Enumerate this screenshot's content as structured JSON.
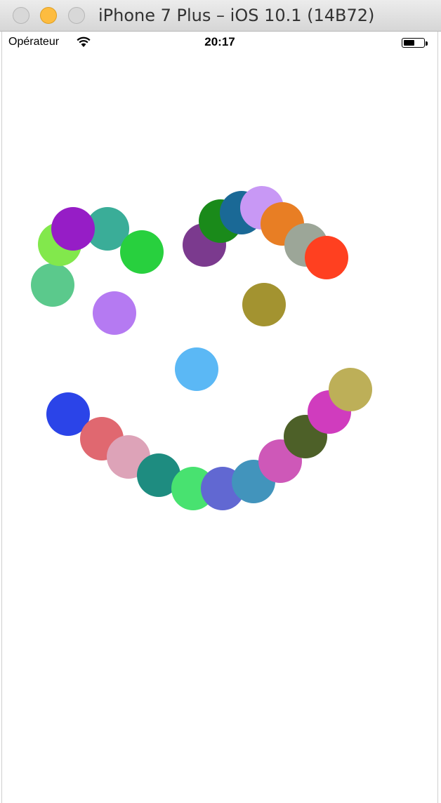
{
  "window": {
    "title": "iPhone 7 Plus – iOS 10.1 (14B72)"
  },
  "status_bar": {
    "carrier": "Opérateur",
    "time": "20:17",
    "battery_level": 0.55
  },
  "dots": [
    {
      "color": "#5BC98C"
    },
    {
      "color": "#82E84C"
    },
    {
      "color": "#3AAD98"
    },
    {
      "color": "#961DC6"
    },
    {
      "color": "#28D03E"
    },
    {
      "color": "#B57AF2"
    },
    {
      "color": "#7B3A8E"
    },
    {
      "color": "#1A8A1A"
    },
    {
      "color": "#1A6996"
    },
    {
      "color": "#C898F5"
    },
    {
      "color": "#E87E24"
    },
    {
      "color": "#9CA698"
    },
    {
      "color": "#FF4020"
    },
    {
      "color": "#A39330"
    },
    {
      "color": "#5BB8F5"
    },
    {
      "color": "#2B44E8"
    },
    {
      "color": "#E06870"
    },
    {
      "color": "#DDA3B8"
    },
    {
      "color": "#1E8C80"
    },
    {
      "color": "#48E270"
    },
    {
      "color": "#6168D2"
    },
    {
      "color": "#4294BC"
    },
    {
      "color": "#CE58B8"
    },
    {
      "color": "#4D6028"
    },
    {
      "color": "#D03CBE"
    },
    {
      "color": "#BDAF58"
    }
  ]
}
